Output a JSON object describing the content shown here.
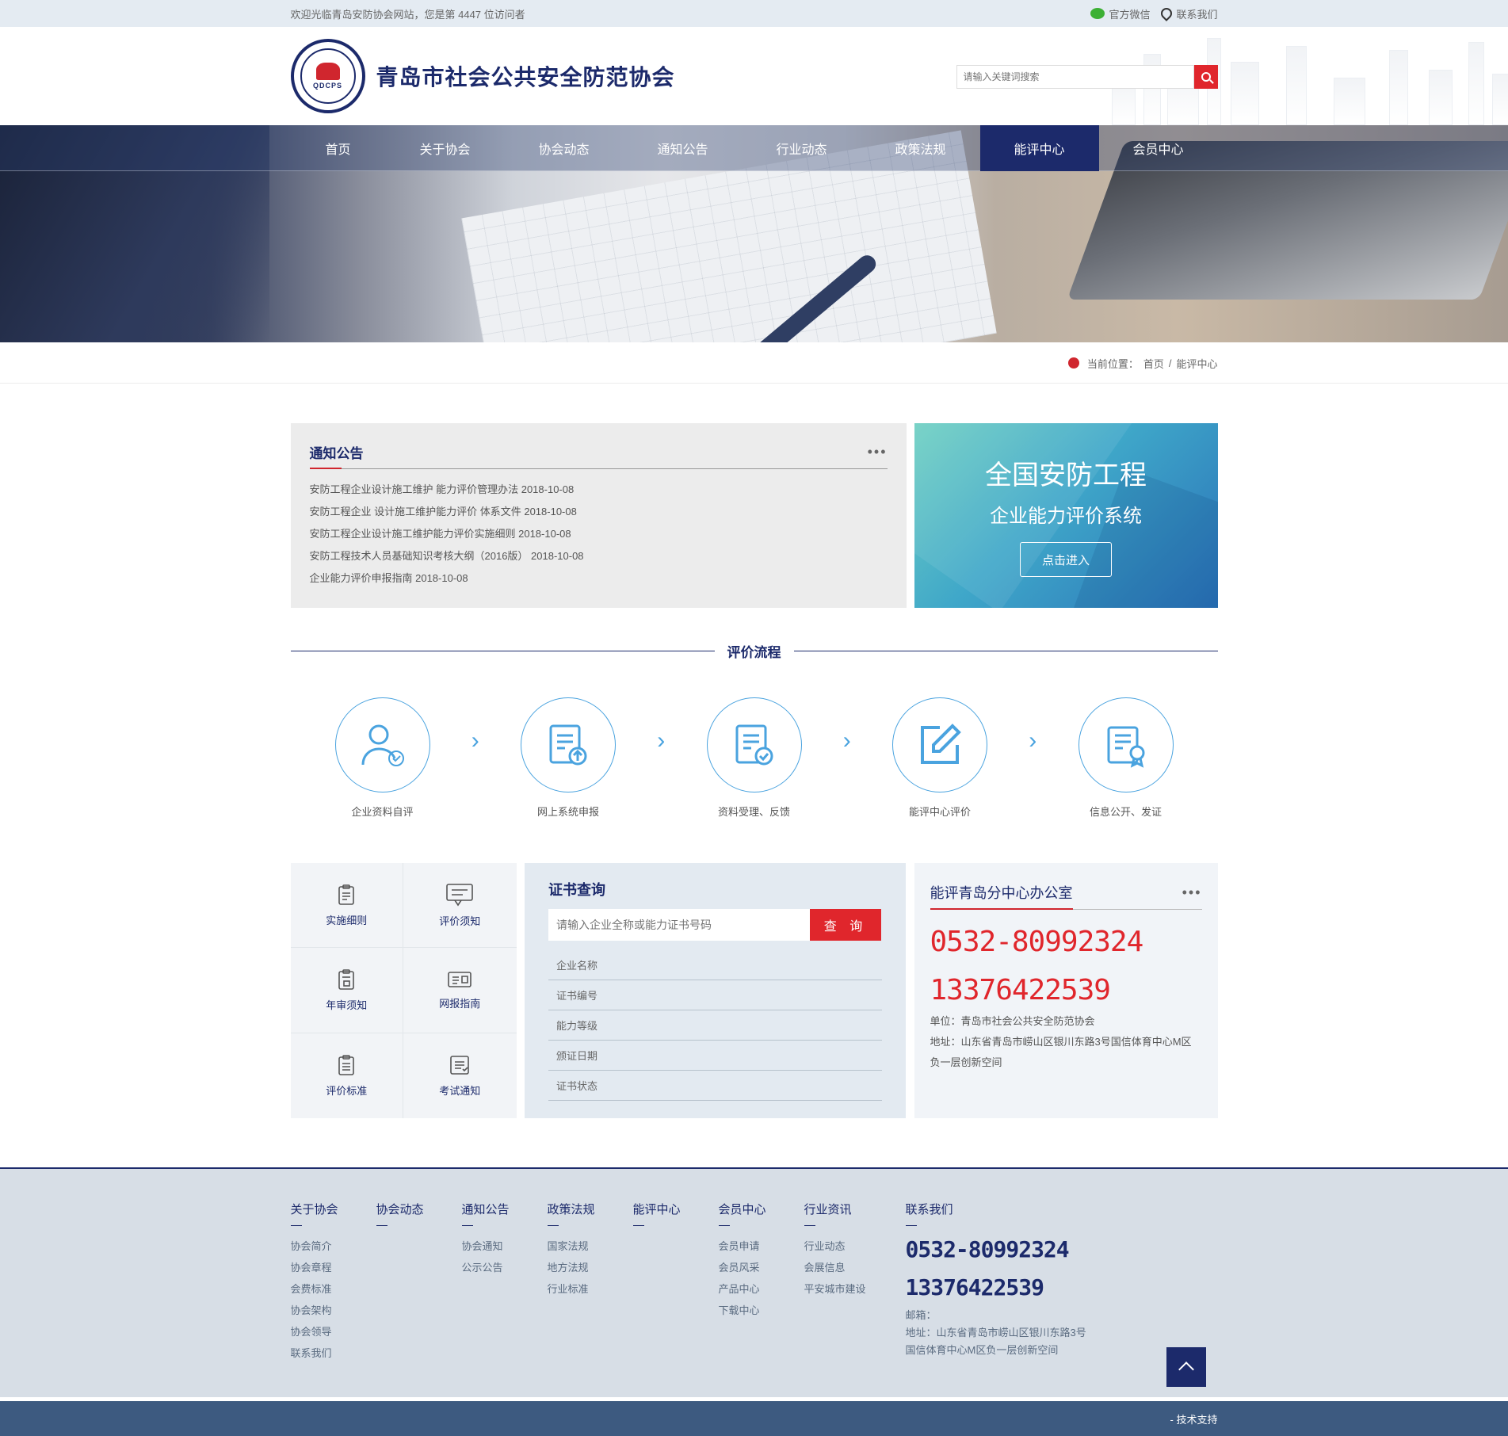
{
  "topbar": {
    "welcome": "欢迎光临青岛安防协会网站，您是第 4447 位访问者",
    "wechat": "官方微信",
    "contact": "联系我们"
  },
  "header": {
    "logo_text": "QDCPS",
    "site_name": "青岛市社会公共安全防范协会",
    "search_placeholder": "请输入关键词搜索"
  },
  "nav": {
    "items": [
      "首页",
      "关于协会",
      "协会动态",
      "通知公告",
      "行业动态",
      "政策法规",
      "能评中心",
      "会员中心"
    ],
    "active": "能评中心"
  },
  "breadcrumb": {
    "label": "当前位置：",
    "home": "首页",
    "sep": "/",
    "current": "能评中心"
  },
  "notice": {
    "title": "通知公告",
    "more": "•••",
    "items": [
      "安防工程企业设计施工维护 能力评价管理办法 2018-10-08",
      "安防工程企业 设计施工维护能力评价 体系文件 2018-10-08",
      "安防工程企业设计施工维护能力评价实施细则 2018-10-08",
      "安防工程技术人员基础知识考核大纲（2016版） 2018-10-08",
      "企业能力评价申报指南 2018-10-08"
    ]
  },
  "eval_system": {
    "title": "全国安防工程",
    "subtitle": "企业能力评价系统",
    "button": "点击进入"
  },
  "process": {
    "title": "评价流程",
    "steps": [
      "企业资料自评",
      "网上系统申报",
      "资料受理、反馈",
      "能评中心评价",
      "信息公开、发证"
    ],
    "arrow": "›"
  },
  "quick_links": [
    "实施细则",
    "评价须知",
    "年审须知",
    "网报指南",
    "评价标准",
    "考试通知"
  ],
  "cert": {
    "title": "证书查询",
    "placeholder": "请输入企业全称或能力证书号码",
    "button": "查 询",
    "fields": [
      "企业名称",
      "证书编号",
      "能力等级",
      "颁证日期",
      "证书状态"
    ]
  },
  "office": {
    "title": "能评青岛分中心办公室",
    "more": "•••",
    "tel1": "0532-80992324",
    "tel2": "13376422539",
    "unit": "单位：青岛市社会公共安全防范协会",
    "address": "地址：山东省青岛市崂山区银川东路3号国信体育中心M区负一层创新空间"
  },
  "footer": {
    "columns": [
      {
        "title": "关于协会",
        "links": [
          "协会简介",
          "协会章程",
          "会费标准",
          "协会架构",
          "协会领导",
          "联系我们"
        ]
      },
      {
        "title": "协会动态",
        "links": []
      },
      {
        "title": "通知公告",
        "links": [
          "协会通知",
          "公示公告"
        ]
      },
      {
        "title": "政策法规",
        "links": [
          "国家法规",
          "地方法规",
          "行业标准"
        ]
      },
      {
        "title": "能评中心",
        "links": []
      },
      {
        "title": "会员中心",
        "links": [
          "会员申请",
          "会员风采",
          "产品中心",
          "下载中心"
        ]
      },
      {
        "title": "行业资讯",
        "links": [
          "行业动态",
          "会展信息",
          "平安城市建设"
        ]
      }
    ],
    "contact": {
      "title": "联系我们",
      "tel1": "0532-80992324",
      "tel2": "13376422539",
      "email": "邮箱：",
      "address1": "地址：山东省青岛市崂山区银川东路3号",
      "address2": "国信体育中心M区负一层创新空间"
    },
    "tech_support": "- 技术支持"
  },
  "colors": {
    "brand": "#1c2a6b",
    "accent": "#e0262c",
    "process_blue": "#4aa3df"
  }
}
